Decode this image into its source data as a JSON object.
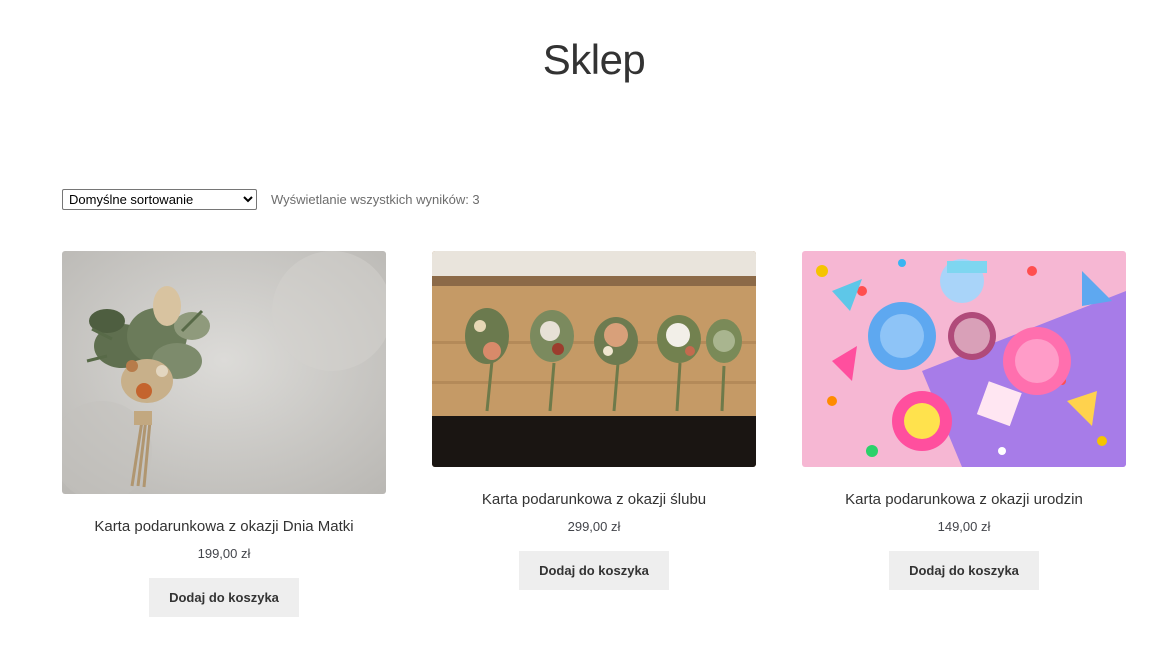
{
  "page": {
    "title": "Sklep"
  },
  "toolbar": {
    "sort_selected": "Domyślne sortowanie",
    "result_count": "Wyświetlanie wszystkich wyników: 3"
  },
  "products": [
    {
      "title": "Karta podarunkowa z okazji Dnia Matki",
      "price": "199,00 zł",
      "button": "Dodaj do koszyka",
      "image": "dried-flower-bouquet"
    },
    {
      "title": "Karta podarunkowa z okazji ślubu",
      "price": "299,00 zł",
      "button": "Dodaj do koszyka",
      "image": "boutonnieres-on-wood"
    },
    {
      "title": "Karta podarunkowa z okazji urodzin",
      "price": "149,00 zł",
      "button": "Dodaj do koszyka",
      "image": "birthday-party-table"
    }
  ],
  "colors": {
    "button_bg": "#eeeeee",
    "text": "#333333",
    "muted": "#6d6d6d"
  }
}
